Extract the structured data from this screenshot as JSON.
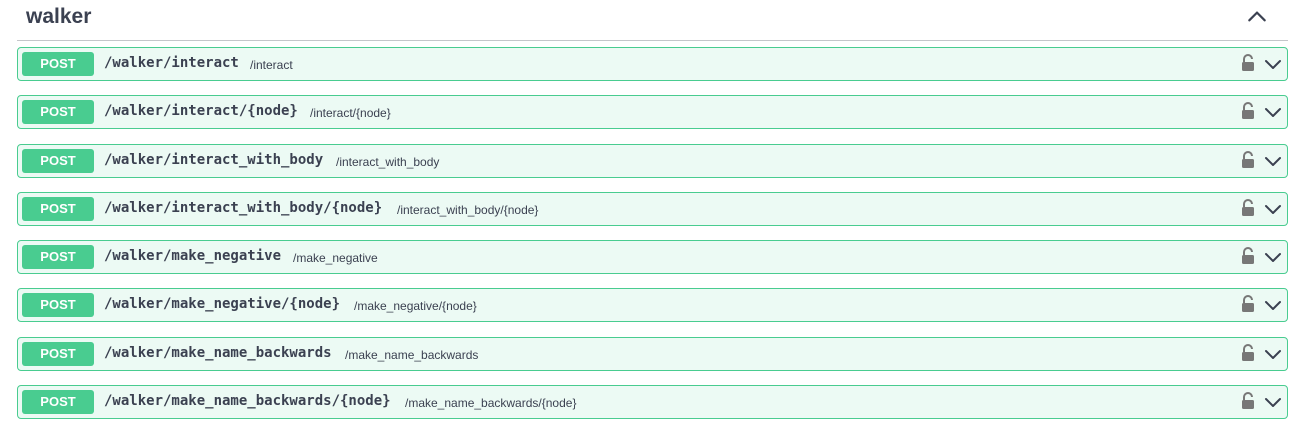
{
  "section": {
    "title": "walker"
  },
  "operations": [
    {
      "method": "POST",
      "path": "/walker/interact",
      "summary": "/interact"
    },
    {
      "method": "POST",
      "path": "/walker/interact/{node}",
      "summary": "/interact/{node}"
    },
    {
      "method": "POST",
      "path": "/walker/interact_with_body",
      "summary": "/interact_with_body"
    },
    {
      "method": "POST",
      "path": "/walker/interact_with_body/{node}",
      "summary": "/interact_with_body/{node}"
    },
    {
      "method": "POST",
      "path": "/walker/make_negative",
      "summary": "/make_negative"
    },
    {
      "method": "POST",
      "path": "/walker/make_negative/{node}",
      "summary": "/make_negative/{node}"
    },
    {
      "method": "POST",
      "path": "/walker/make_name_backwards",
      "summary": "/make_name_backwards"
    },
    {
      "method": "POST",
      "path": "/walker/make_name_backwards/{node}",
      "summary": "/make_name_backwards/{node}"
    }
  ],
  "colors": {
    "post": "#49cc90",
    "text": "#3b4151"
  },
  "icons": {
    "collapse": "chevron-up-icon",
    "lock": "unlocked-padlock-icon",
    "expand": "chevron-down-icon"
  }
}
